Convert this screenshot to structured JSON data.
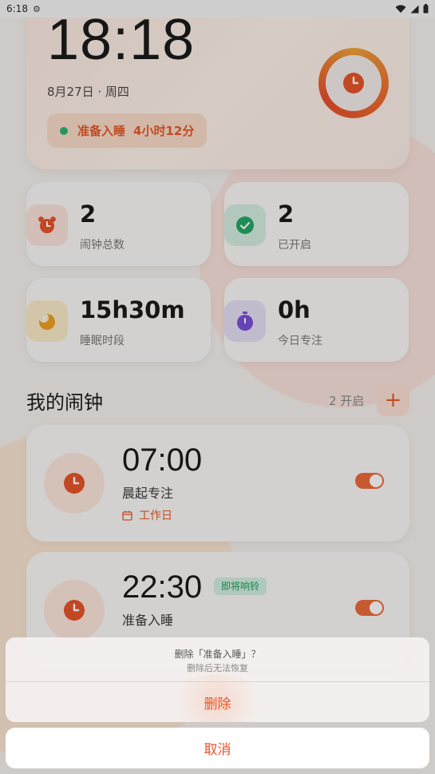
{
  "status_bar": {
    "time": "6:18"
  },
  "hero": {
    "time": "18:18",
    "date": "8月27日 · 周四",
    "next_label": "准备入睡",
    "next_countdown": "4小时12分"
  },
  "stats": [
    {
      "value": "2",
      "label": "闹钟总数",
      "icon": "alarm-clock-icon"
    },
    {
      "value": "2",
      "label": "已开启",
      "icon": "check-circle-icon"
    },
    {
      "value": "15h30m",
      "label": "睡眠时段",
      "icon": "moon-icon"
    },
    {
      "value": "0h",
      "label": "今日专注",
      "icon": "timer-icon"
    }
  ],
  "section": {
    "title": "我的闹钟",
    "count": "2 开启",
    "add": "+"
  },
  "alarms": [
    {
      "time": "07:00",
      "name": "晨起专注",
      "repeat": "工作日",
      "enabled": true
    },
    {
      "time": "22:30",
      "name": "准备入睡",
      "badge": "即将响铃",
      "enabled": true
    }
  ],
  "dialog": {
    "title": "删除「准备入睡」？",
    "subtitle": "删除后无法恢复",
    "delete_label": "删除",
    "cancel_label": "取消"
  },
  "colors": {
    "accent": "#e55b2a",
    "success": "#2bb673",
    "background": "#f5f1ee"
  }
}
